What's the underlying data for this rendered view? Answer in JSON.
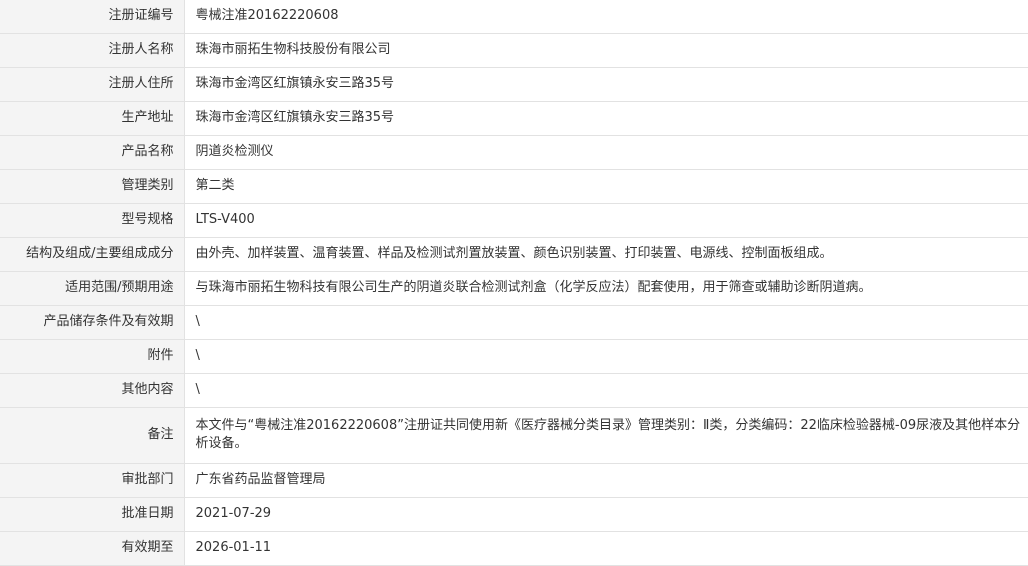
{
  "rows": [
    {
      "label": "注册证编号",
      "value": "粤械注准20162220608"
    },
    {
      "label": "注册人名称",
      "value": "珠海市丽拓生物科技股份有限公司"
    },
    {
      "label": "注册人住所",
      "value": "珠海市金湾区红旗镇永安三路35号"
    },
    {
      "label": "生产地址",
      "value": "珠海市金湾区红旗镇永安三路35号"
    },
    {
      "label": "产品名称",
      "value": "阴道炎检测仪"
    },
    {
      "label": "管理类别",
      "value": "第二类"
    },
    {
      "label": "型号规格",
      "value": "LTS-V400"
    },
    {
      "label": "结构及组成/主要组成成分",
      "value": "由外壳、加样装置、温育装置、样品及检测试剂置放装置、颜色识别装置、打印装置、电源线、控制面板组成。"
    },
    {
      "label": "适用范围/预期用途",
      "value": "与珠海市丽拓生物科技有限公司生产的阴道炎联合检测试剂盒（化学反应法）配套使用，用于筛查或辅助诊断阴道病。"
    },
    {
      "label": "产品储存条件及有效期",
      "value": "\\"
    },
    {
      "label": "附件",
      "value": "\\"
    },
    {
      "label": "其他内容",
      "value": "\\"
    },
    {
      "label": "备注",
      "value": "本文件与“粤械注准20162220608”注册证共同使用新《医疗器械分类目录》管理类别：Ⅱ类，分类编码：22临床检验器械-09尿液及其他样本分析设备。"
    },
    {
      "label": "审批部门",
      "value": "广东省药品监督管理局"
    },
    {
      "label": "批准日期",
      "value": "2021-07-29"
    },
    {
      "label": "有效期至",
      "value": "2026-01-11"
    }
  ]
}
